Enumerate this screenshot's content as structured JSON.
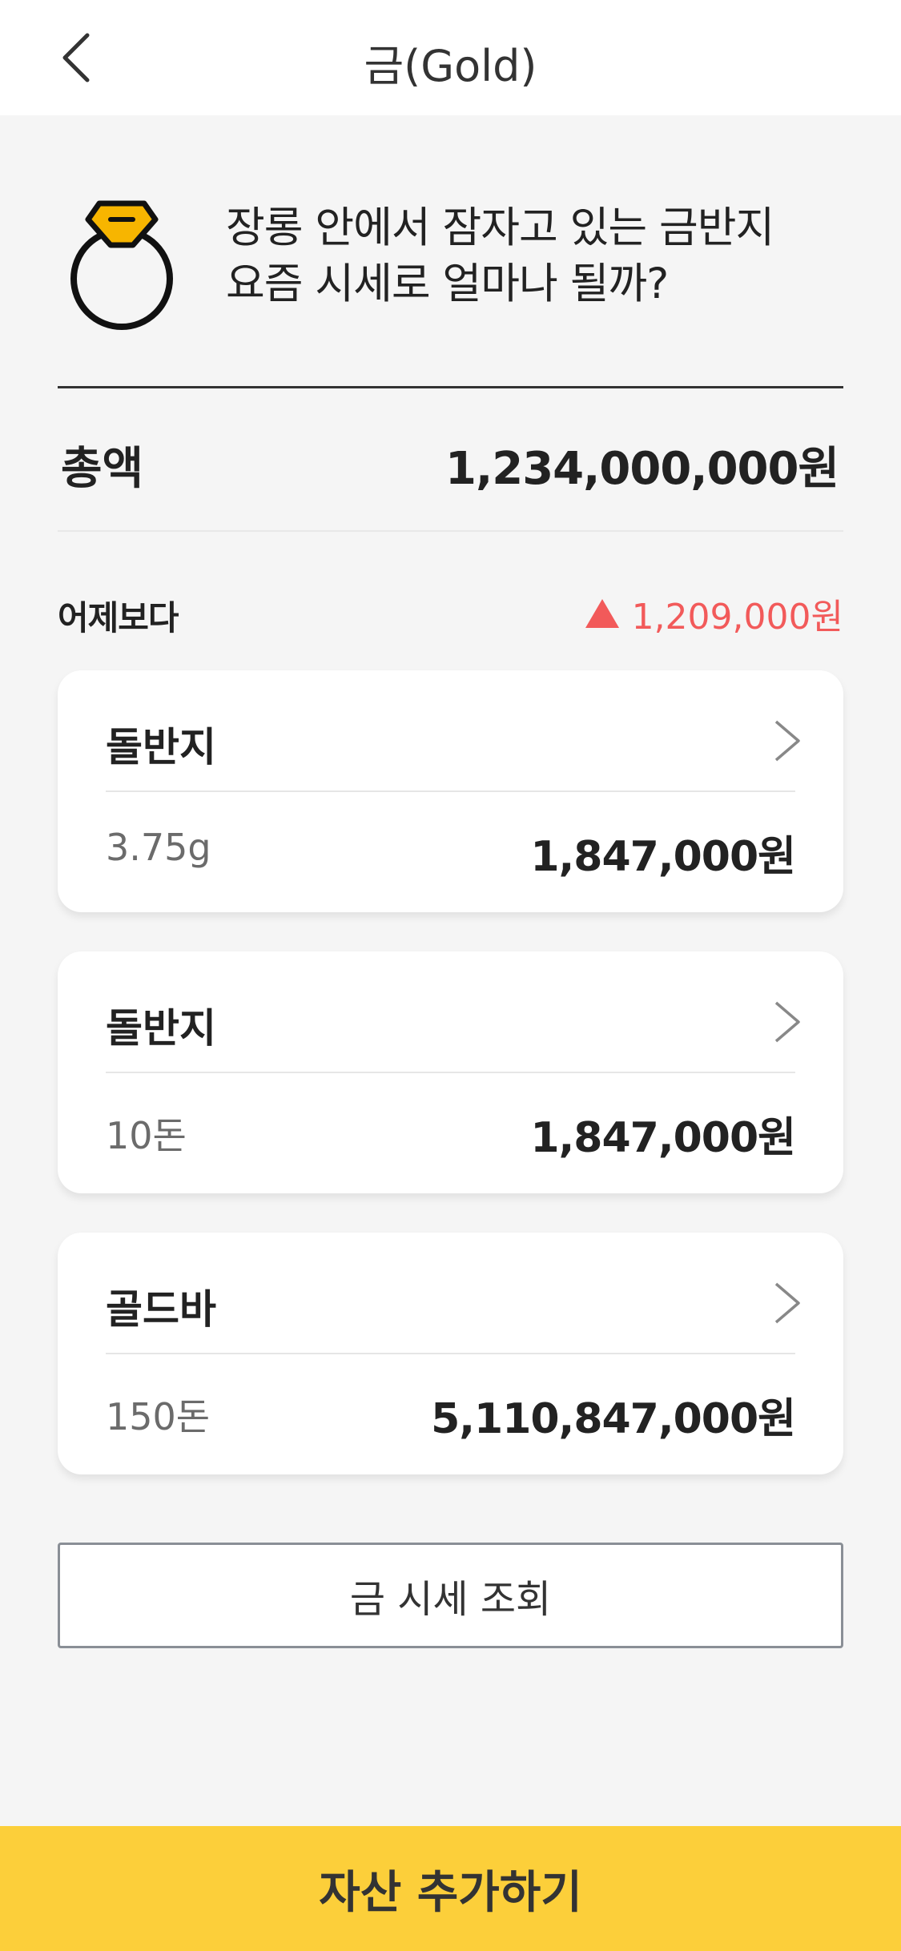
{
  "header": {
    "title": "금(Gold)",
    "back_icon": "chevron-left-icon"
  },
  "intro": {
    "icon": "gold-ring-icon",
    "line1": "장롱 안에서 잠자고 있는 금반지",
    "line2": "요즘 시세로 얼마나 될까?"
  },
  "total": {
    "label": "총액",
    "value": "1,234,000,000원"
  },
  "daily_change": {
    "label": "어제보다",
    "value": "1,209,000원",
    "direction_icon": "triangle-up-icon",
    "color": "#f25a5a"
  },
  "items": [
    {
      "title": "돌반지",
      "quantity": "3.75g",
      "amount": "1,847,000원"
    },
    {
      "title": "돌반지",
      "quantity": "10돈",
      "amount": "1,847,000원"
    },
    {
      "title": "골드바",
      "quantity": "150돈",
      "amount": "5,110,847,000원"
    }
  ],
  "buttons": {
    "lookup": "금 시세 조회",
    "add_asset": "자산 추가하기"
  },
  "colors": {
    "accent_yellow": "#fccf3a",
    "ring_gem": "#f7b500",
    "increase_red": "#f25a5a"
  }
}
